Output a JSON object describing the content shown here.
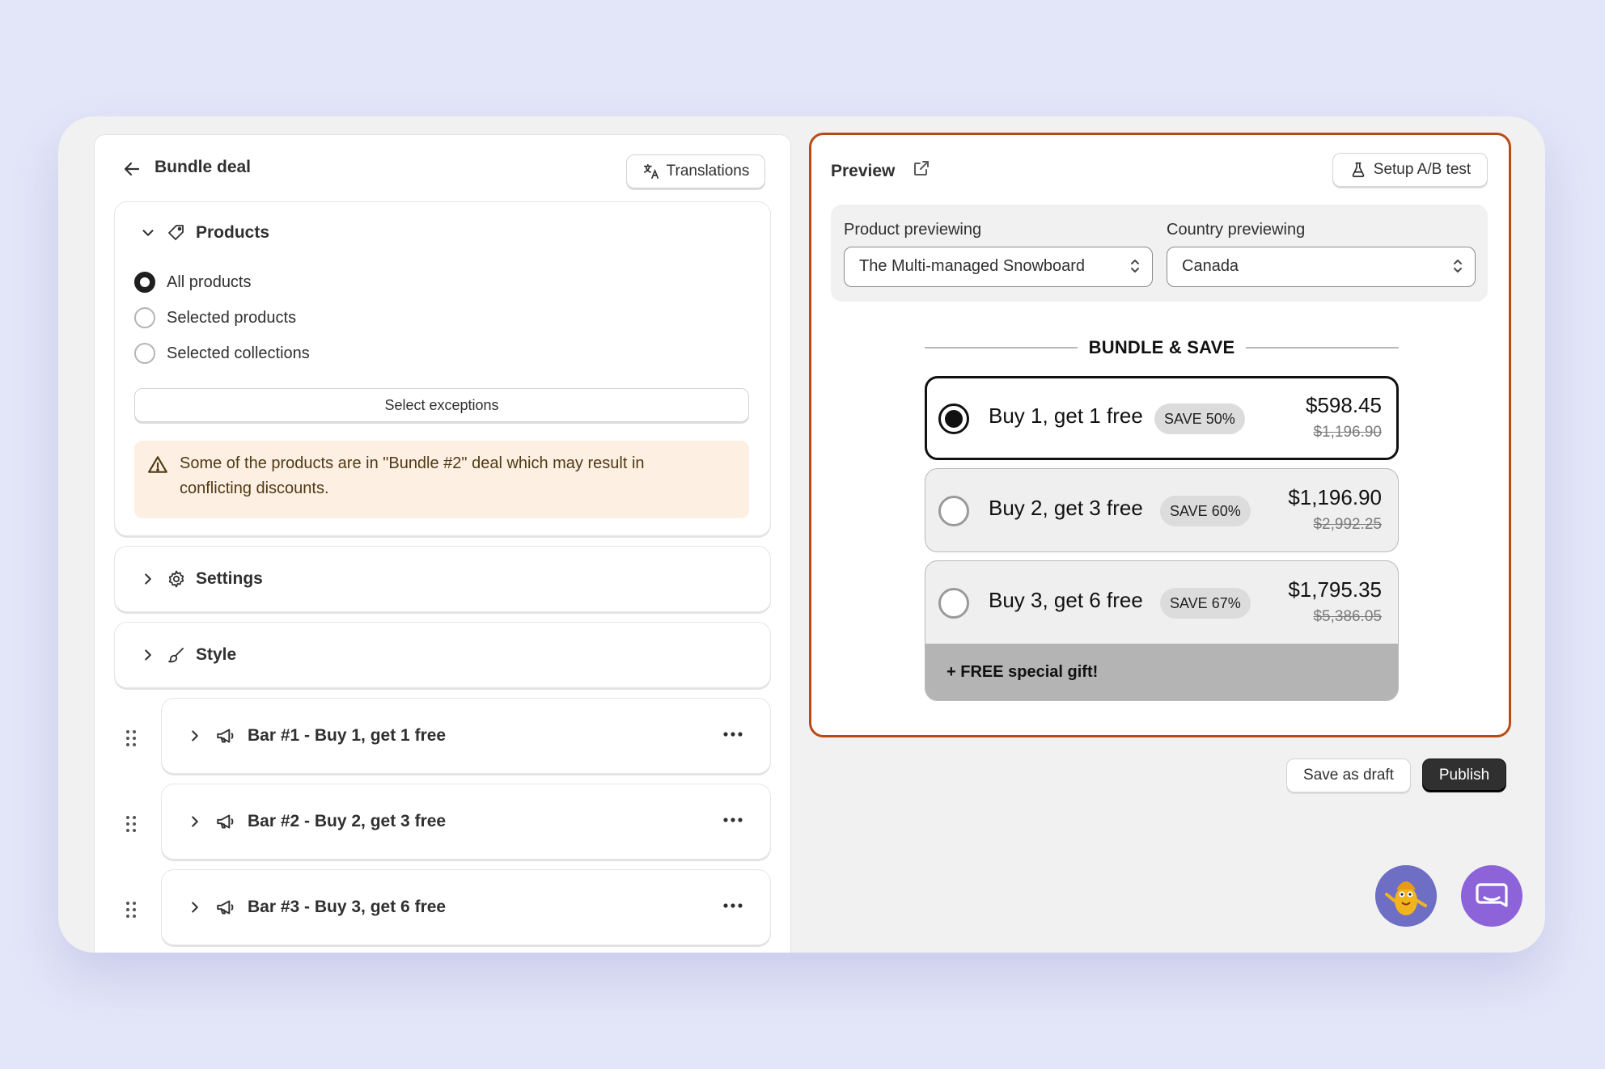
{
  "header": {
    "title": "Bundle deal",
    "translations_label": "Translations"
  },
  "products": {
    "title": "Products",
    "options": [
      {
        "label": "All products",
        "selected": true
      },
      {
        "label": "Selected products",
        "selected": false
      },
      {
        "label": "Selected collections",
        "selected": false
      }
    ],
    "select_exceptions_label": "Select exceptions",
    "warning_line1": "Some of the products are in \"Bundle #2\" deal which may result in",
    "warning_line2": "conflicting discounts."
  },
  "settings": {
    "title": "Settings"
  },
  "style": {
    "title": "Style"
  },
  "bars": [
    {
      "title": "Bar #1 - Buy 1, get 1 free"
    },
    {
      "title": "Bar #2 - Buy 2, get 3 free"
    },
    {
      "title": "Bar #3 - Buy 3, get 6 free"
    }
  ],
  "preview": {
    "title": "Preview",
    "ab_test_label": "Setup A/B test",
    "product_label": "Product previewing",
    "product_value": "The Multi-managed Snowboard",
    "country_label": "Country previewing",
    "country_value": "Canada",
    "heading": "BUNDLE & SAVE",
    "offers": [
      {
        "title": "Buy 1, get 1 free",
        "badge": "SAVE 50%",
        "price": "$598.45",
        "old_price": "$1,196.90",
        "selected": true
      },
      {
        "title": "Buy 2, get 3 free",
        "badge": "SAVE 60%",
        "price": "$1,196.90",
        "old_price": "$2,992.25",
        "selected": false
      },
      {
        "title": "Buy 3, get 6 free",
        "badge": "SAVE 67%",
        "price": "$1,795.35",
        "old_price": "$5,386.05",
        "selected": false,
        "gift": "+ FREE special gift!"
      }
    ]
  },
  "actions": {
    "save_draft_label": "Save as draft",
    "publish_label": "Publish"
  },
  "colors": {
    "preview_border": "#b84b15",
    "warning_bg": "#fdefe2",
    "publish_bg": "#303030",
    "chat_bg": "#8c63d9"
  }
}
